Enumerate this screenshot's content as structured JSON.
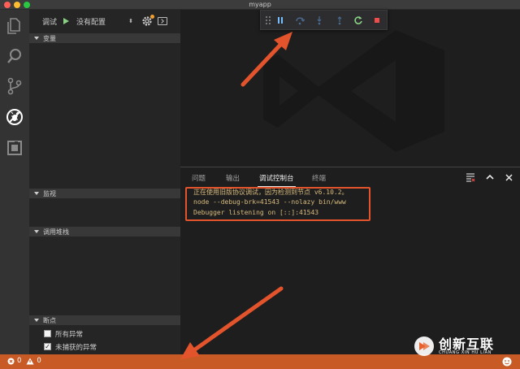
{
  "window": {
    "title": "myapp"
  },
  "activity_bar": {
    "icons": [
      "files-icon",
      "search-icon",
      "source-control-icon",
      "debug-icon",
      "extensions-icon"
    ],
    "active": "debug-icon"
  },
  "debug_toolbar": {
    "label": "调试",
    "config_value": "没有配置"
  },
  "sections": {
    "variables": "变量",
    "watch": "监视",
    "call_stack": "调用堆栈",
    "breakpoints": "断点"
  },
  "breakpoints": [
    {
      "label": "所有异常",
      "checked": false
    },
    {
      "label": "未捕获的异常",
      "checked": true
    }
  ],
  "float_toolbar": {
    "buttons": [
      "drag-handle-icon",
      "pause-icon",
      "step-over-icon",
      "step-into-icon",
      "step-out-icon",
      "restart-icon",
      "stop-icon"
    ]
  },
  "panel": {
    "tabs": [
      "问题",
      "输出",
      "调试控制台",
      "终端"
    ],
    "active_tab": "调试控制台",
    "console_lines": [
      "正在使用旧版协议调试，因为检测到节点 v6.10.2。",
      "node --debug-brk=41543 --nolazy bin/www",
      "Debugger listening on [::]:41543"
    ]
  },
  "status_bar": {
    "errors": "0",
    "warnings": "0"
  },
  "watermark": {
    "main": "创新互联",
    "sub": "CHUANG XIN HU LIAN"
  },
  "colors": {
    "status_bar": "#c85a25",
    "annotation": "#e3542c",
    "console_text": "#d7ba7d"
  }
}
